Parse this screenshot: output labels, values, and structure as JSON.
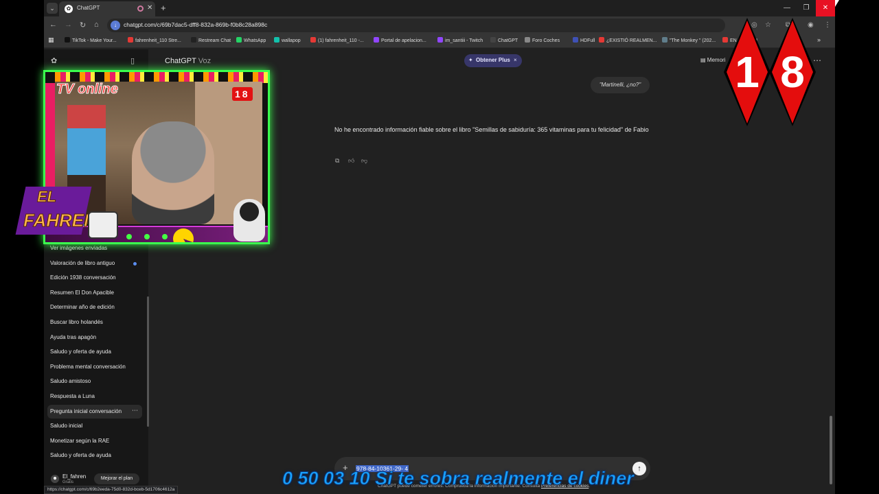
{
  "browser": {
    "tab_title": "ChatGPT",
    "url": "chatgpt.com/c/69b7dac5-dff8-832a-869b-f0b8c28a898c",
    "bookmarks": [
      "TikTok - Make Your...",
      "fahrenheit_110 Stre...",
      "Restream Chat",
      "WhatsApp",
      "wallapop",
      "(1) fahrenheit_110 -...",
      "Portal de apelacion...",
      "im_santiii - Twitch",
      "ChatGPT",
      "Foro Coches",
      "HDFull",
      "¿EXISTIÓ REALMEN...",
      "\"The Monkey \" (202...",
      "EN Official U"
    ],
    "bookmark_colors": [
      "#111111",
      "#e53935",
      "#222222",
      "#25d366",
      "#13c1ac",
      "#e53935",
      "#9146ff",
      "#9146ff",
      "#444444",
      "#888888",
      "#3f51b5",
      "#e53935",
      "#607d8b",
      "#e53935"
    ],
    "status_url": "https://chatgpt.com/c/69b2eeda-75d0-832d-bceb-5d1706c4612a"
  },
  "sidebar": {
    "items": [
      {
        "label": "Ver imágenes enviadas"
      },
      {
        "label": "Valoración de libro antiguo"
      },
      {
        "label": "Edición 1938 conversación"
      },
      {
        "label": "Resumen El Don Apacible"
      },
      {
        "label": "Determinar año de edición"
      },
      {
        "label": "Buscar libro holandés"
      },
      {
        "label": "Ayuda tras apagón"
      },
      {
        "label": "Saludo y oferta de ayuda"
      },
      {
        "label": "Problema mental conversación"
      },
      {
        "label": "Saludo amistoso"
      },
      {
        "label": "Respuesta a Luna"
      },
      {
        "label": "Pregunta inicial conversación"
      },
      {
        "label": "Saludo inicial"
      },
      {
        "label": "Monetizar según la RAE"
      },
      {
        "label": "Saludo y oferta de ayuda"
      }
    ],
    "user": {
      "name": "El_fahren",
      "plan": "Gratis",
      "upgrade_label": "Mejorar el plan"
    }
  },
  "main": {
    "title": "ChatGPT",
    "title_sub": "Voz",
    "plus_pill": "Obtener Plus",
    "memory_label": "Memori",
    "user_message": "\"Martinelli, ¿no?\"",
    "assistant_message": "No he encontrado información fiable sobre el libro \"Semillas de sabiduría: 365 vitaminas para tu felicidad\" de Fabio",
    "composer_text": "978-84-10361-29- 4",
    "footnote": "ChatGPT puede cometer errores. Comprueba la información importante. Consulta",
    "footnote_link": "Preferencias de cookies",
    "footnote_end": "."
  },
  "overlay": {
    "tv_online": "TV online",
    "cam_badge": "18",
    "logo_line1": "EL",
    "logo_line2": "FAHREN",
    "age_digit_1": "1",
    "age_digit_2": "8",
    "ticker": "0 50 03 10 Si te sobra realmente el diner"
  }
}
